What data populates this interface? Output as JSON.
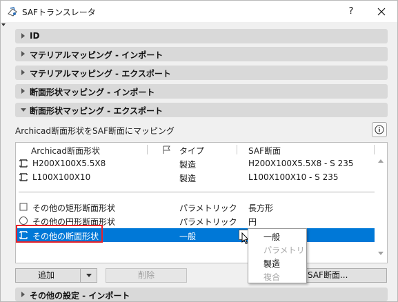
{
  "window": {
    "title": "SAFトランスレータ",
    "help_label": "?"
  },
  "sections": [
    {
      "label": "ID",
      "expanded": false
    },
    {
      "label": "マテリアルマッピング - インポート",
      "expanded": false
    },
    {
      "label": "マテリアルマッピング - エクスポート",
      "expanded": false
    },
    {
      "label": "断面形状マッピング - インポート",
      "expanded": false
    },
    {
      "label": "断面形状マッピング - エクスポート",
      "expanded": true
    }
  ],
  "mapping": {
    "description": "Archicad断面形状をSAF断面にマッピング",
    "columns": [
      "Archicad断面形状",
      "タイプ",
      "SAF断面"
    ],
    "rows": [
      {
        "name": "H200X100X5.5X8",
        "type": "製造",
        "saf": "H200X100X5.5X8 - S 235",
        "icon": "beam-profile-icon"
      },
      {
        "name": "L100X100X10",
        "type": "製造",
        "saf": "L100X100X10 - S 235",
        "icon": "beam-profile-icon"
      }
    ],
    "other_rows": [
      {
        "name": "その他の矩形断面形状",
        "type": "パラメトリック",
        "saf": "長方形",
        "icon": "rectangle-icon"
      },
      {
        "name": "その他の円形断面形状",
        "type": "パラメトリック",
        "saf": "円",
        "icon": "circle-icon"
      },
      {
        "name": "その他の断面形状",
        "type": "一般",
        "saf": "",
        "icon": "beam-profile-icon",
        "selected": true
      }
    ]
  },
  "type_dropdown": {
    "options": [
      {
        "label": "一般",
        "enabled": true
      },
      {
        "label": "パラメトリック",
        "enabled": false
      },
      {
        "label": "製造",
        "enabled": true
      },
      {
        "label": "複合",
        "enabled": false
      }
    ]
  },
  "buttons": {
    "add": "追加",
    "delete": "削除",
    "saf_section": "SAF断面..."
  },
  "bottom_section": {
    "label": "その他の設定 - インポート",
    "expanded": false
  },
  "colors": {
    "selection": "#0078d7",
    "highlight_box": "#e8222a",
    "section_bg": "#d9d9d9"
  }
}
